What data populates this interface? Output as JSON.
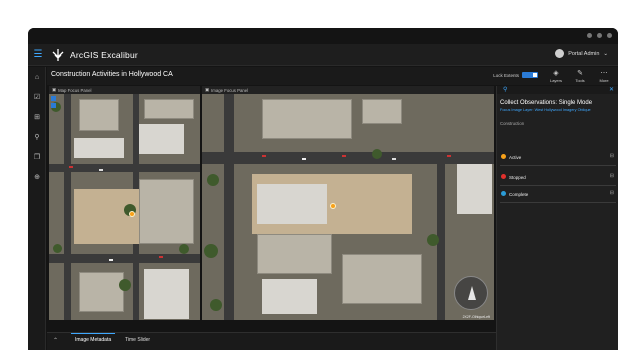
{
  "app": {
    "name": "ArcGIS Excalibur"
  },
  "user": {
    "name": "Portal Admin"
  },
  "page": {
    "title": "Construction Activities in Hollywood CA"
  },
  "toolbar": {
    "lock_extents_label": "Lock Extents",
    "layers_label": "Layers",
    "tools_label": "Tools",
    "more_label": "More"
  },
  "map_panel": {
    "title": "Map Focus Panel"
  },
  "image_panel": {
    "title": "Image Focus Panel",
    "overlay_label": "2X2F-OlhiqueLeft"
  },
  "collect_panel": {
    "title": "Collect Observations: Single Mode",
    "subtitle": "Focus Image Layer: West Hollywood Imagery Oblique",
    "section": "Construction",
    "items": [
      {
        "label": "Active",
        "color": "#f7a11a"
      },
      {
        "label": "Stopped",
        "color": "#e0302c"
      },
      {
        "label": "Complete",
        "color": "#2b9bd6"
      }
    ]
  },
  "bottom": {
    "tabs": [
      "Image Metadata",
      "Time Slider"
    ]
  },
  "colors": {
    "accent": "#3ea8ff",
    "background": "#141414",
    "panel": "#202020"
  },
  "icons": {
    "menu": "hamburger-icon",
    "logo": "excalibur-logo",
    "home": "home-icon",
    "layers": "layers-icon",
    "tools": "tools-icon",
    "more": "more-icon",
    "close": "close-icon",
    "pin": "pin-icon",
    "lock": "lock-icon",
    "compass": "compass-icon"
  }
}
